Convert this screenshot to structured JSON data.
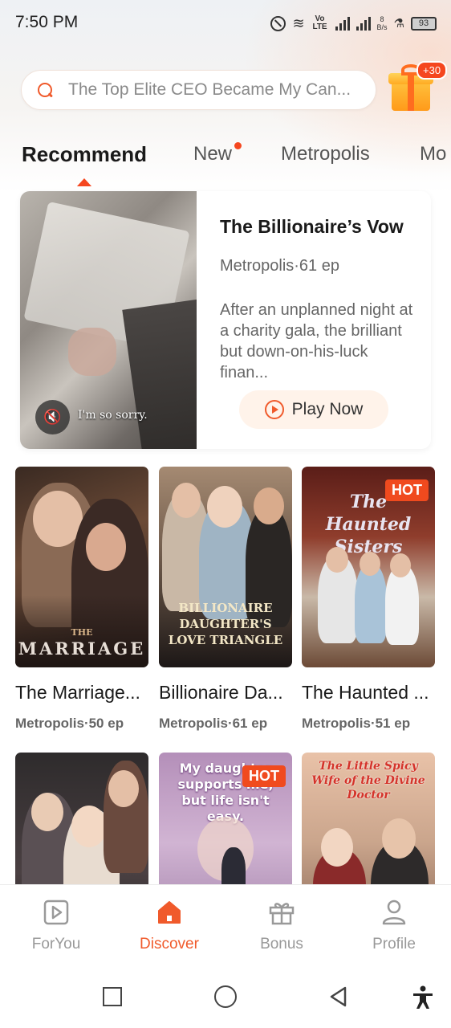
{
  "status_bar": {
    "time": "7:50 PM",
    "volte": "Vo LTE",
    "speed_value": "8",
    "speed_unit": "B/s",
    "battery": "93"
  },
  "search": {
    "placeholder": "The Top Elite CEO Became My Can..."
  },
  "gift": {
    "badge": "+30"
  },
  "tabs": [
    "Recommend",
    "New",
    "Metropolis",
    "Mo"
  ],
  "featured": {
    "title": "The Billionaire’s Vow",
    "meta": "Metropolis·61 ep",
    "description": "After an unplanned night at a charity gala, the brilliant but down-on-his-luck finan...",
    "play_label": "Play Now",
    "subtitle": "I'm so sorry."
  },
  "grid": [
    {
      "title": "The Marriage...",
      "meta": "Metropolis·50 ep",
      "cover_text": "MARRIAGE",
      "cover_subtext": "THE",
      "hot": ""
    },
    {
      "title": "Billionaire Da...",
      "meta": "Metropolis·61 ep",
      "cover_text": "BILLIONAIRE DAUGHTER'S LOVE TRIANGLE",
      "hot": ""
    },
    {
      "title": "The Haunted ...",
      "meta": "Metropolis·51 ep",
      "cover_text": "The Haunted Sisters",
      "hot": "HOT"
    },
    {
      "title": "",
      "meta": "",
      "cover_text": "",
      "hot": ""
    },
    {
      "title": "",
      "meta": "",
      "cover_text": "My daughter supports me, but life isn't easy.",
      "hot": "HOT"
    },
    {
      "title": "",
      "meta": "",
      "cover_text": "The Little Spicy Wife of the Divine Doctor",
      "hot": ""
    }
  ],
  "bottom_nav": [
    {
      "label": "ForYou",
      "icon": "play-square-icon"
    },
    {
      "label": "Discover",
      "icon": "home-icon"
    },
    {
      "label": "Bonus",
      "icon": "gift-icon"
    },
    {
      "label": "Profile",
      "icon": "person-icon"
    }
  ],
  "colors": {
    "accent": "#f05a2b",
    "hot": "#f04a1e"
  }
}
